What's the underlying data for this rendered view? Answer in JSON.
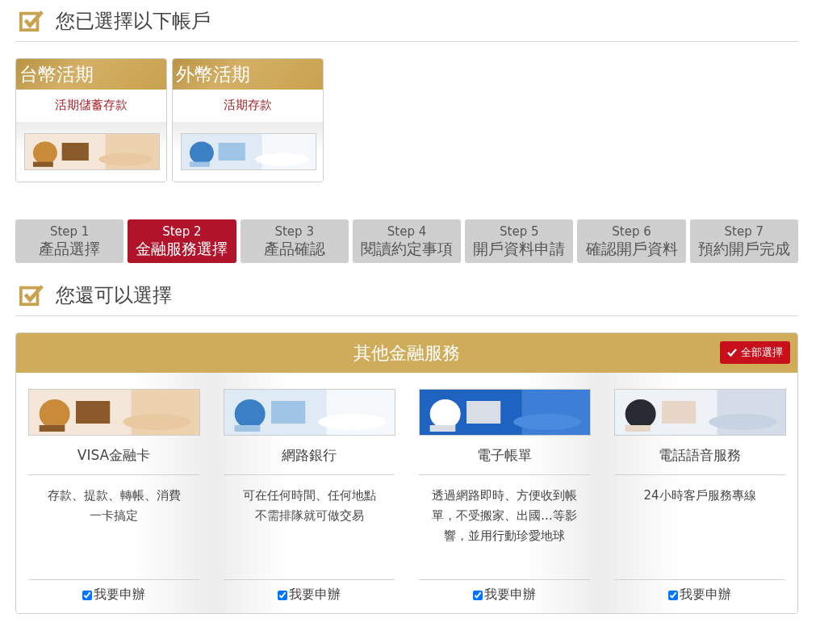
{
  "selected_section": {
    "title": "您已選擇以下帳戶"
  },
  "accounts": [
    {
      "category": "台幣活期",
      "product": "活期儲蓄存款"
    },
    {
      "category": "外幣活期",
      "product": "活期存款"
    }
  ],
  "steps": [
    {
      "step": "Step 1",
      "label": "產品選擇",
      "selected": false
    },
    {
      "step": "Step 2",
      "label": "金融服務選擇",
      "selected": true
    },
    {
      "step": "Step 3",
      "label": "產品確認",
      "selected": false
    },
    {
      "step": "Step 4",
      "label": "閱讀約定事項",
      "selected": false
    },
    {
      "step": "Step 5",
      "label": "開戶資料申請",
      "selected": false
    },
    {
      "step": "Step 6",
      "label": "確認開戶資料",
      "selected": false
    },
    {
      "step": "Step 7",
      "label": "預約開戶完成",
      "selected": false
    }
  ],
  "options_section": {
    "title": "您還可以選擇"
  },
  "services_panel": {
    "title": "其他金融服務",
    "select_all": "全部選擇",
    "services": [
      {
        "name": "VISA金融卡",
        "description": [
          "存款、提款、轉帳、消費",
          "一卡搞定"
        ],
        "apply_label": "我要申辦",
        "checked": true
      },
      {
        "name": "網路銀行",
        "description": [
          "可在任何時間、任何地點",
          "不需排隊就可做交易"
        ],
        "apply_label": "我要申辦",
        "checked": true
      },
      {
        "name": "電子帳單",
        "description": [
          "透過網路即時、方便收到帳",
          "單，不受搬家、出國...等影",
          "響，並用行動珍愛地球"
        ],
        "apply_label": "我要申辦",
        "checked": true
      },
      {
        "name": "電話語音服務",
        "description": [
          "24小時客戶服務專線"
        ],
        "apply_label": "我要申辦",
        "checked": true
      }
    ]
  }
}
